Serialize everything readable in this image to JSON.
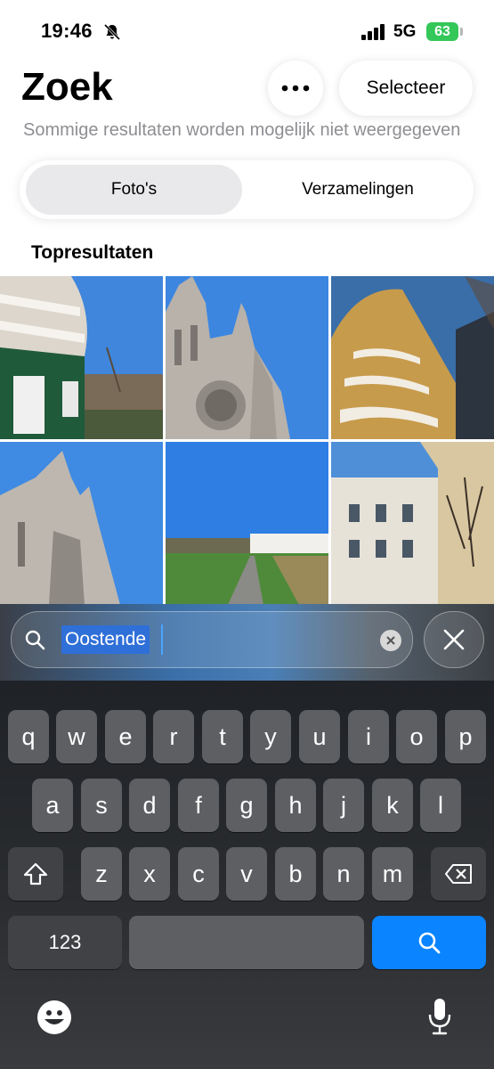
{
  "status_bar": {
    "time": "19:46",
    "network": "5G",
    "battery": "63"
  },
  "header": {
    "title": "Zoek",
    "more_icon": "ellipsis-icon",
    "select_label": "Selecteer",
    "subtitle": "Sommige resultaten worden mogelijk niet weergegeven"
  },
  "segments": {
    "photos": "Foto's",
    "collections": "Verzamelingen",
    "active": "photos"
  },
  "section": {
    "label": "Topresultaten"
  },
  "results": [
    "photo-building-balconies",
    "photo-gothic-church",
    "photo-round-apartment-building",
    "photo-church-towers",
    "photo-path-field",
    "photo-white-building-tree"
  ],
  "search": {
    "value": "Oostende",
    "search_icon": "magnifier-icon",
    "clear_icon": "clear-icon",
    "cancel_icon": "close-icon"
  },
  "keyboard": {
    "row1": [
      "q",
      "w",
      "e",
      "r",
      "t",
      "y",
      "u",
      "i",
      "o",
      "p"
    ],
    "row2": [
      "a",
      "s",
      "d",
      "f",
      "g",
      "h",
      "j",
      "k",
      "l"
    ],
    "row3": [
      "z",
      "x",
      "c",
      "v",
      "b",
      "n",
      "m"
    ],
    "numbers_key": "123",
    "shift_icon": "shift-icon",
    "delete_icon": "backspace-icon",
    "search_icon": "search-key-icon",
    "emoji_icon": "emoji-icon",
    "dictation_icon": "microphone-icon"
  },
  "colors": {
    "accent": "#0a84ff",
    "battery": "#34c759",
    "selection": "#2f6fd8"
  }
}
